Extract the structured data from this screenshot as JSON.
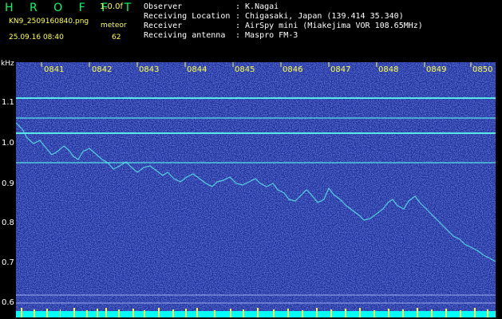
{
  "app": {
    "name": "H R O F F T",
    "version": "1.0.0f",
    "file_name": "KN9_2509160840.png",
    "timestamp": "25.09.16 08:40",
    "meteor_label": "meteor",
    "meteor_count": "62"
  },
  "info": [
    {
      "key": "Observer",
      "value": ": K.Nagai"
    },
    {
      "key": "Receiving Location",
      "value": ": Chigasaki, Japan (139.414 35.340)"
    },
    {
      "key": "Receiver",
      "value": ": AirSpy mini (Miakejima VOR 108.65MHz)"
    },
    {
      "key": "Receiving antenna",
      "value": ": Maspro FM-3"
    }
  ],
  "axis": {
    "y_unit": "kHz",
    "y_ticks": [
      "1.1",
      "1.0",
      "0.9",
      "0.8",
      "0.7",
      "0.6"
    ],
    "x_ticks": [
      "0841",
      "0842",
      "0843",
      "0844",
      "0845",
      "0846",
      "0847",
      "0848",
      "0849",
      "0850"
    ]
  },
  "colors": {
    "background": "#000000",
    "waterfall": "#1a2a9a",
    "carrier": "#58e8e8",
    "label": "#ffff40",
    "bottom_bar": "#00ffff"
  }
}
